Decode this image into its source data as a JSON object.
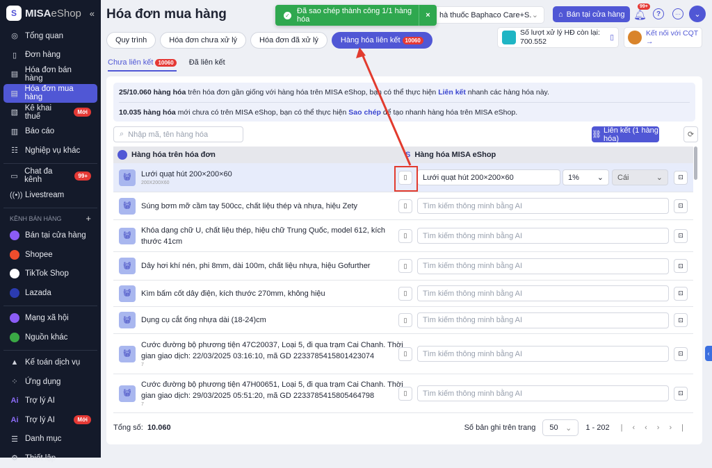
{
  "sidebar": {
    "brand": "MISA",
    "brand2": "eShop",
    "collapse": "«",
    "items": [
      {
        "label": "Tổng quan",
        "icon": "◎"
      },
      {
        "label": "Đơn hàng",
        "icon": "▯"
      },
      {
        "label": "Hóa đơn bán hàng",
        "icon": "▤"
      },
      {
        "label": "Hóa đơn mua hàng",
        "icon": "▤"
      },
      {
        "label": "Kê khai thuế",
        "icon": "▧",
        "badge": "Mới"
      },
      {
        "label": "Báo cáo",
        "icon": "▥"
      },
      {
        "label": "Nghiệp vụ khác",
        "icon": "☷"
      }
    ],
    "items2": [
      {
        "label": "Chat đa kênh",
        "icon": "▭",
        "badge": "99+"
      },
      {
        "label": "Livestream",
        "icon": "((•))"
      }
    ],
    "section": "KÊNH BÁN HÀNG",
    "section_add": "+",
    "channels": [
      {
        "label": "Bán tại cửa hàng",
        "color": "#8b5cf6"
      },
      {
        "label": "Shopee",
        "color": "#ee4d2d"
      },
      {
        "label": "TikTok Shop",
        "color": "#ffffff"
      },
      {
        "label": "Lazada",
        "color": "#2b3bb0"
      }
    ],
    "channels2": [
      {
        "label": "Mạng xã hội",
        "color": "#8b5cf6"
      },
      {
        "label": "Nguồn khác",
        "color": "#3aa845"
      }
    ],
    "items3": [
      {
        "label": "Kế toán dịch vụ",
        "icon": "▲"
      },
      {
        "label": "Ứng dụng",
        "icon": "⁘"
      },
      {
        "label": "Trợ lý AI",
        "icon": "Ai"
      },
      {
        "label": "Trợ lý AI",
        "icon": "Ai",
        "badge": "Mới"
      },
      {
        "label": "Danh mục",
        "icon": "☰"
      },
      {
        "label": "Thiết lập",
        "icon": "⚙"
      }
    ]
  },
  "header": {
    "title": "Hóa đơn mua hàng",
    "store": "hà thuốc Baphaco Care+S...",
    "sell_btn": "Bán tại cửa hàng",
    "notif": "99+",
    "quota_label": "Số lượt xử lý HĐ còn lại:",
    "quota_value": "700.552",
    "cqt": "Kết nối với CQT →"
  },
  "toast": {
    "text": "Đã sao chép thành công 1/1 hàng hóa",
    "close": "×"
  },
  "tabs": [
    {
      "label": "Quy trình"
    },
    {
      "label": "Hóa đơn chưa xử lý"
    },
    {
      "label": "Hóa đơn đã xử lý"
    },
    {
      "label": "Hàng hóa liên kết",
      "count": "10060"
    }
  ],
  "subtabs": {
    "a": "Chưa liên kết",
    "a_count": "10060",
    "b": "Đã liên kết"
  },
  "info": {
    "l1_b": "25/10.060 hàng hóa",
    "l1_t": " trên hóa đơn gần giống với hàng hóa trên MISA eShop, bạn có thể thực hiện ",
    "l1_link": "Liên kết",
    "l1_e": " nhanh các hàng hóa này.",
    "l2_b": "10.035 hàng hóa",
    "l2_t": " mới chưa có trên MISA eShop, bạn có thể thực hiện ",
    "l2_link": "Sao chép",
    "l2_e": " để tạo nhanh hàng hóa trên MISA eShop."
  },
  "toolbar": {
    "search_placeholder": "Nhập mã, tên hàng hóa",
    "link_btn": "Liên kết (1 hàng hóa)"
  },
  "table": {
    "col1": "Hàng hóa trên hóa đơn",
    "col2": "Hàng hóa MISA eShop",
    "ai_placeholder": "Tìm kiếm thông minh bằng AI",
    "rows": [
      {
        "name": "Lưới quạt hút 200×200×60",
        "sub": "200X200X60",
        "match": "Lưới quạt hút 200×200×60",
        "tax": "1%",
        "unit": "Cái"
      },
      {
        "name": "Súng bơm mỡ cầm tay 500cc, chất liệu thép và nhựa, hiệu Zety"
      },
      {
        "name": "Khóa dạng chữ U, chất liệu thép, hiệu chữ Trung Quốc, model 612, kích thước 41cm"
      },
      {
        "name": "Dây hơi khí nén, phi 8mm, dài 100m, chất liệu nhựa, hiệu Gofurther"
      },
      {
        "name": "Kìm bấm cốt dây điện, kích thước 270mm, không hiệu"
      },
      {
        "name": "Dụng cụ cắt ống nhựa dài (18-24)cm"
      },
      {
        "name": "Cước đường bộ phương tiện 47C20037, Loại 5, đi qua trạm Cai Chanh. Thời gian giao dịch: 22/03/2025 03:16:10, mã GD 2233785415801423074",
        "sub": "7"
      },
      {
        "name": "Cước đường bộ phương tiện 47H00651, Loại 5, đi qua trạm Cai Chanh. Thời gian giao dịch: 29/03/2025 05:51:20, mã GD 2233785415805464798",
        "sub": "7"
      }
    ]
  },
  "footer": {
    "total_label": "Tổng số:",
    "total": "10.060",
    "per_page_label": "Số bản ghi trên trang",
    "per_page": "50",
    "range": "1 - 202"
  }
}
